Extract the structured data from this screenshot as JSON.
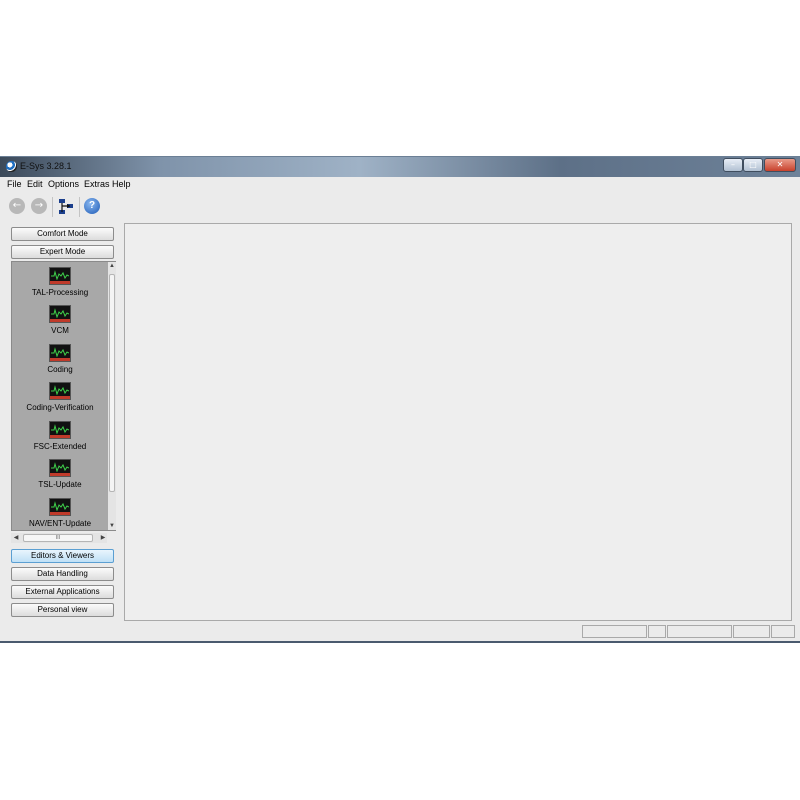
{
  "window": {
    "title": "E-Sys 3.28.1"
  },
  "menu": {
    "items": [
      "File",
      "Edit",
      "Options",
      "Extras",
      "Help"
    ]
  },
  "toolbar": {
    "back_icon": "back-arrow-icon",
    "forward_icon": "forward-arrow-icon",
    "connection_icon": "network-connection-icon",
    "help_icon": "help-icon",
    "help_glyph": "?"
  },
  "sidebar": {
    "comfort_mode": "Comfort Mode",
    "expert_mode": "Expert Mode",
    "expert_items": [
      {
        "label": "TAL-Processing",
        "icon": "monitor-wave-icon"
      },
      {
        "label": "VCM",
        "icon": "monitor-wave-icon"
      },
      {
        "label": "Coding",
        "icon": "monitor-wave-icon"
      },
      {
        "label": "Coding-Verification",
        "icon": "monitor-wave-icon"
      },
      {
        "label": "FSC-Extended",
        "icon": "monitor-wave-icon"
      },
      {
        "label": "TSL-Update",
        "icon": "monitor-wave-icon"
      },
      {
        "label": "NAV/ENT-Update",
        "icon": "monitor-wave-icon"
      }
    ],
    "scroll_grip": "III",
    "editors_viewers": "Editors & Viewers",
    "data_handling": "Data Handling",
    "external_applications": "External Applications",
    "personal_view": "Personal view"
  },
  "colors": {
    "window_bg": "#ebebeb",
    "list_bg": "#a8a8a8",
    "active_button": "#bfe0f6",
    "icon_wave": "#3fd14b"
  }
}
